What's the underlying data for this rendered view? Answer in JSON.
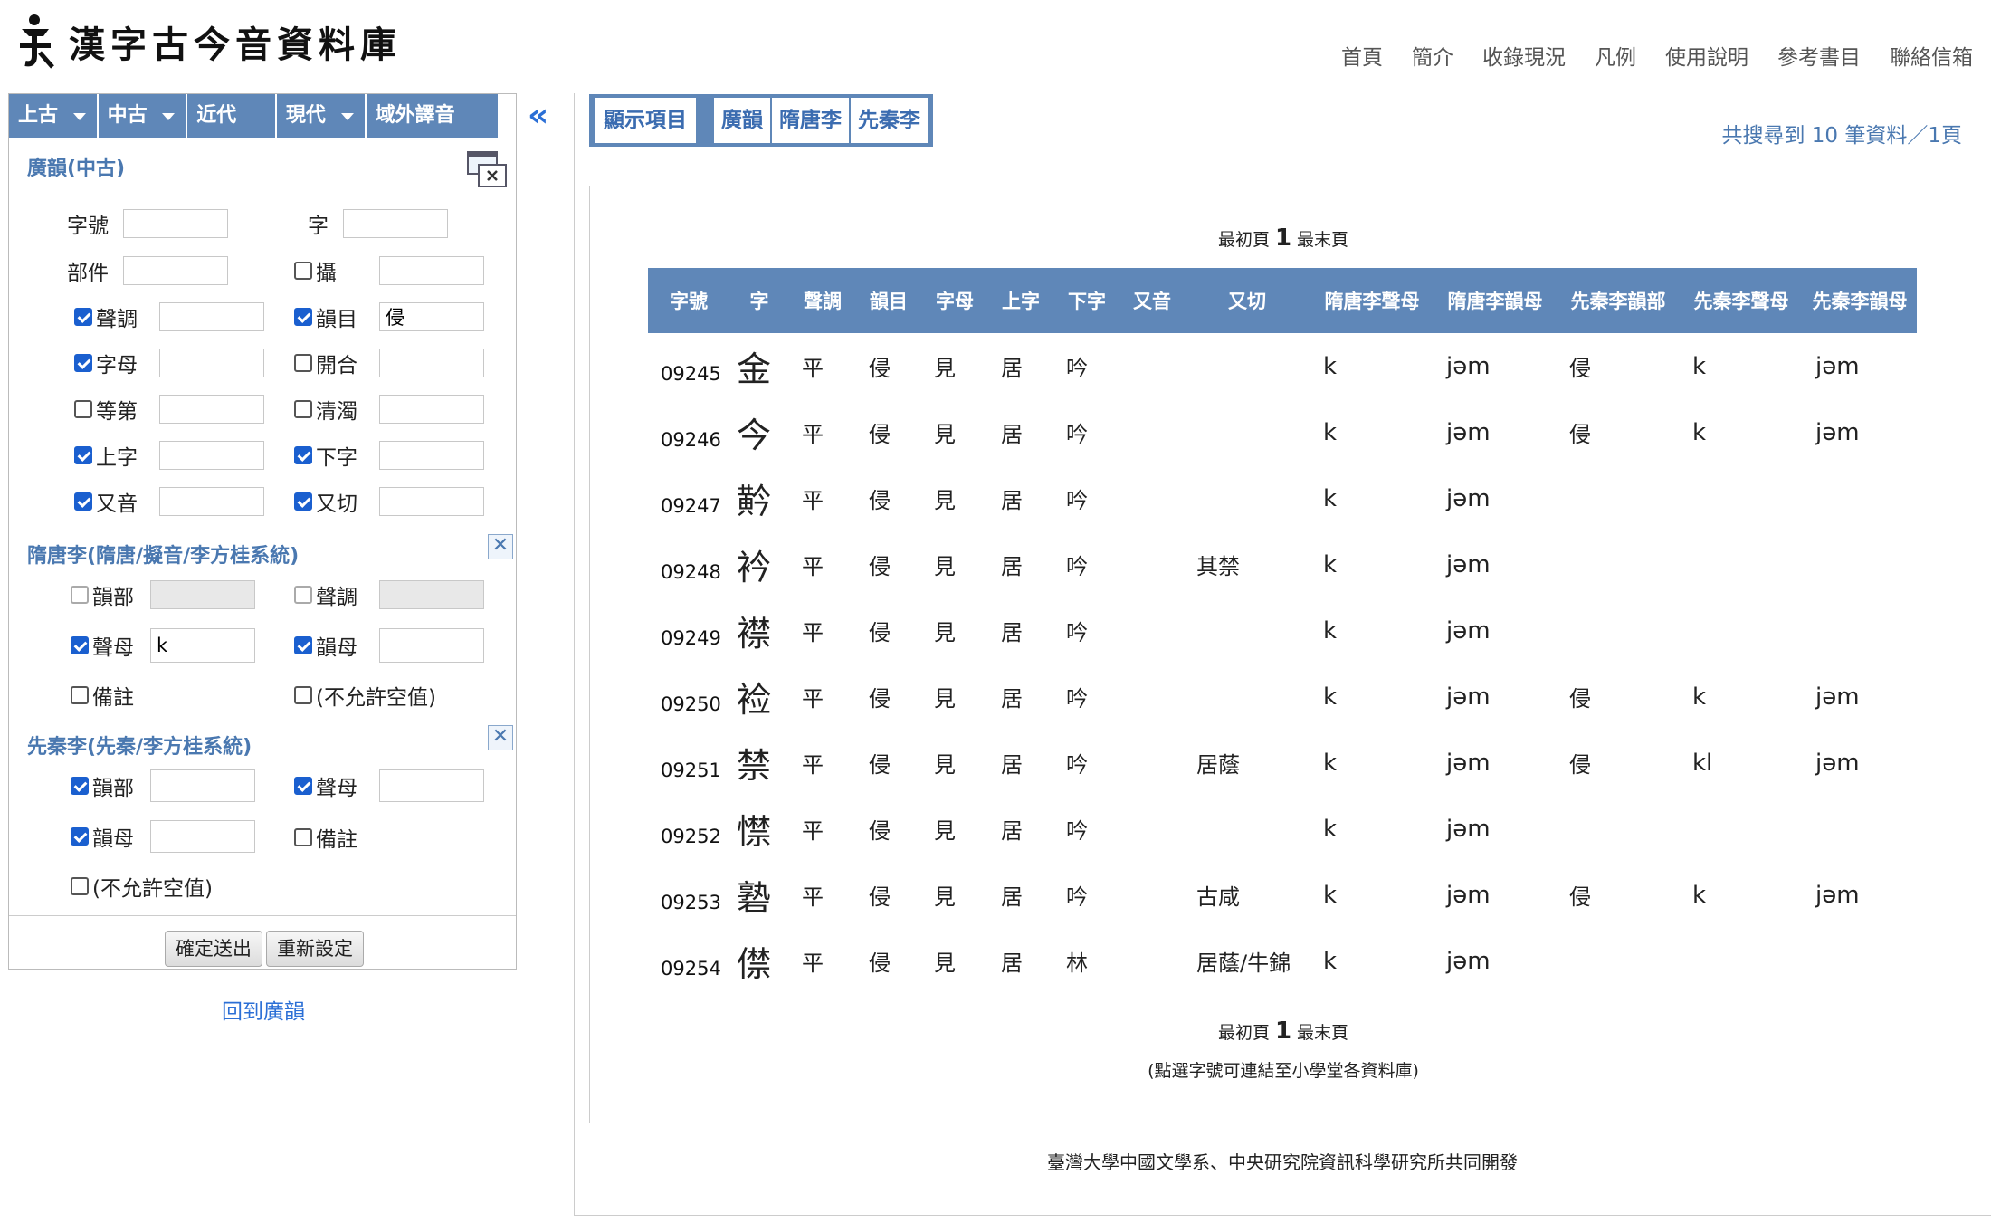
{
  "header": {
    "title": "漢字古今音資料庫",
    "nav": [
      "首頁",
      "簡介",
      "收錄現況",
      "凡例",
      "使用說明",
      "參考書目",
      "聯絡信箱"
    ]
  },
  "left": {
    "era_tabs": [
      "上古",
      "中古",
      "近代",
      "現代",
      "域外譯音"
    ],
    "guangyun": {
      "title": "廣韻(中古)",
      "fields": {
        "zihao": {
          "label": "字號",
          "value": ""
        },
        "zi": {
          "label": "字",
          "value": ""
        },
        "bujian": {
          "label": "部件",
          "value": ""
        },
        "she": {
          "label": "攝",
          "value": ""
        },
        "shengdiao": {
          "label": "聲調",
          "value": ""
        },
        "yunmu": {
          "label": "韻目",
          "value": "侵"
        },
        "zimu": {
          "label": "字母",
          "value": ""
        },
        "kaihe": {
          "label": "開合",
          "value": ""
        },
        "dengdi": {
          "label": "等第",
          "value": ""
        },
        "qingzhuo": {
          "label": "清濁",
          "value": ""
        },
        "shangzi": {
          "label": "上字",
          "value": ""
        },
        "xiazi": {
          "label": "下字",
          "value": ""
        },
        "youyin": {
          "label": "又音",
          "value": ""
        },
        "youqie": {
          "label": "又切",
          "value": ""
        }
      }
    },
    "suitang": {
      "title": "隋唐李(隋唐/擬音/李方桂系統)",
      "close": "✕",
      "fields": {
        "yunbu": {
          "label": "韻部",
          "value": ""
        },
        "shengdiao": {
          "label": "聲調",
          "value": ""
        },
        "shengmu": {
          "label": "聲母",
          "value": "k"
        },
        "yunmu": {
          "label": "韻母",
          "value": ""
        },
        "beizhu": {
          "label": "備註"
        },
        "nonull": {
          "label": "(不允許空值)"
        }
      }
    },
    "xianqin": {
      "title": "先秦李(先秦/李方桂系統)",
      "close": "✕",
      "fields": {
        "yunbu": {
          "label": "韻部",
          "value": ""
        },
        "shengmu": {
          "label": "聲母",
          "value": ""
        },
        "yunmu": {
          "label": "韻母",
          "value": ""
        },
        "beizhu": {
          "label": "備註"
        },
        "nonull": {
          "label": "(不允許空值)"
        }
      }
    },
    "buttons": {
      "submit": "確定送出",
      "reset": "重新設定"
    },
    "back_link": "回到廣韻",
    "collapse_icon": "«"
  },
  "right": {
    "tabs": [
      "顯示項目",
      "廣韻",
      "隋唐李",
      "先秦李"
    ],
    "summary": "共搜尋到 10 筆資料／1頁",
    "pager": {
      "first": "最初頁",
      "page": "1",
      "last": "最末頁"
    },
    "note": "(點選字號可連結至小學堂各資料庫)"
  },
  "table": {
    "headers": [
      "字號",
      "字",
      "聲調",
      "韻目",
      "字母",
      "上字",
      "下字",
      "又音",
      "又切",
      "隋唐李聲母",
      "隋唐李韻母",
      "先秦李韻部",
      "先秦李聲母",
      "先秦李韻母"
    ],
    "rows": [
      [
        "09245",
        "金",
        "平",
        "侵",
        "見",
        "居",
        "吟",
        "",
        "",
        "k",
        "jəm",
        "侵",
        "k",
        "jəm"
      ],
      [
        "09246",
        "今",
        "平",
        "侵",
        "見",
        "居",
        "吟",
        "",
        "",
        "k",
        "jəm",
        "侵",
        "k",
        "jəm"
      ],
      [
        "09247",
        "黅",
        "平",
        "侵",
        "見",
        "居",
        "吟",
        "",
        "",
        "k",
        "jəm",
        "",
        "",
        ""
      ],
      [
        "09248",
        "衿",
        "平",
        "侵",
        "見",
        "居",
        "吟",
        "",
        "其禁",
        "k",
        "jəm",
        "",
        "",
        ""
      ],
      [
        "09249",
        "襟",
        "平",
        "侵",
        "見",
        "居",
        "吟",
        "",
        "",
        "k",
        "jəm",
        "",
        "",
        ""
      ],
      [
        "09250",
        "裣",
        "平",
        "侵",
        "見",
        "居",
        "吟",
        "",
        "",
        "k",
        "jəm",
        "侵",
        "k",
        "jəm"
      ],
      [
        "09251",
        "禁",
        "平",
        "侵",
        "見",
        "居",
        "吟",
        "",
        "居蔭",
        "k",
        "jəm",
        "侵",
        "kl",
        "jəm"
      ],
      [
        "09252",
        "㦗",
        "平",
        "侵",
        "見",
        "居",
        "吟",
        "",
        "",
        "k",
        "jəm",
        "",
        "",
        ""
      ],
      [
        "09253",
        "䃞",
        "平",
        "侵",
        "見",
        "居",
        "吟",
        "",
        "古咸",
        "k",
        "jəm",
        "侵",
        "k",
        "jəm"
      ],
      [
        "09254",
        "僸",
        "平",
        "侵",
        "見",
        "居",
        "林",
        "",
        "居蔭/牛錦",
        "k",
        "jəm",
        "",
        "",
        ""
      ]
    ]
  },
  "footer": {
    "credits": "臺灣大學中國文學系、中央研究院資訊科學研究所共同開發"
  },
  "colors": {
    "accent": "#5f87b8",
    "link": "#2b6fd6",
    "checkbox": "#1a5fcf"
  }
}
